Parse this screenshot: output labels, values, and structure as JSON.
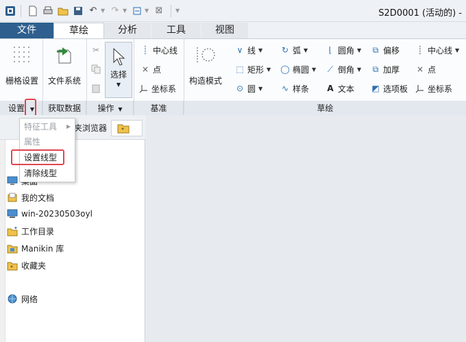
{
  "window": {
    "title": "S2D0001 (活动的) -"
  },
  "tabs": [
    {
      "label": "文件"
    },
    {
      "label": "草绘"
    },
    {
      "label": "分析"
    },
    {
      "label": "工具"
    },
    {
      "label": "视图"
    }
  ],
  "ribbon": {
    "groups": {
      "settings": {
        "label": "设置",
        "grid_button": "栅格设置"
      },
      "get_data": {
        "label": "获取数据",
        "file_system_button": "文件系统"
      },
      "operations": {
        "label": "操作",
        "select_button": "选择"
      },
      "datum": {
        "label": "基准",
        "centerline": "中心线",
        "point": "点",
        "coord_sys": "坐标系"
      },
      "sketch": {
        "label": "草绘",
        "construction_mode": "构造模式",
        "line": "线",
        "rectangle": "矩形",
        "circle": "圆",
        "arc": "弧",
        "ellipse": "椭圆",
        "spline": "样条",
        "fillet": "圆角",
        "chamfer": "倒角",
        "text": "文本",
        "offset": "偏移",
        "thicken": "加厚",
        "palette": "选项板",
        "centerline": "中心线",
        "point": "点",
        "coord_sys": "坐标系"
      }
    }
  },
  "dropdown_menu": {
    "items": [
      {
        "label": "特征工具",
        "enabled": false
      },
      {
        "label": "属性",
        "enabled": false
      },
      {
        "label": "设置线型",
        "enabled": true,
        "highlighted": true
      },
      {
        "label": "清除线型",
        "enabled": true
      }
    ]
  },
  "left_panel": {
    "tab_label": "夹浏览器",
    "tree": [
      {
        "label": "桌面",
        "icon": "desktop-icon"
      },
      {
        "label": "我的文档",
        "icon": "documents-icon"
      },
      {
        "label": "win-20230503oyl",
        "icon": "computer-icon"
      },
      {
        "label": "工作目录",
        "icon": "working-dir-icon"
      },
      {
        "label": "Manikin 库",
        "icon": "library-icon"
      },
      {
        "label": "收藏夹",
        "icon": "favorites-icon"
      },
      {
        "label": "网络",
        "icon": "network-icon"
      }
    ]
  },
  "colors": {
    "file_tab": "#2e5f8e",
    "highlight": "#e04550",
    "accent_blue": "#2d6fb3"
  }
}
